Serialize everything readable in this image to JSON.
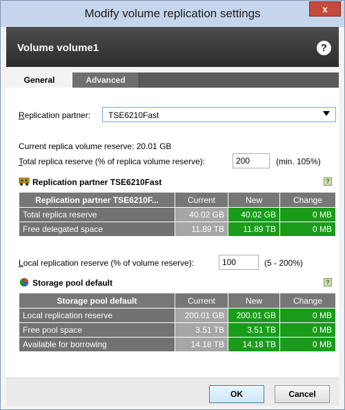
{
  "window": {
    "title": "Modify volume replication settings",
    "close_glyph": "x"
  },
  "header": {
    "title": "Volume volume1",
    "help_glyph": "?"
  },
  "tabs": [
    {
      "label": "General",
      "active": true
    },
    {
      "label": "Advanced",
      "active": false
    }
  ],
  "replication_partner": {
    "label_prefix": "R",
    "label_rest": "eplication partner:",
    "value": "TSE6210Fast"
  },
  "replica": {
    "current_reserve_text": "Current replica volume reserve:  20.01 GB",
    "total_label_prefix": "T",
    "total_label_rest": "otal replica reserve (% of replica volume reserve):",
    "total_value": "200",
    "total_hint": "(min. 105%)"
  },
  "partner_section": {
    "title": "Replication partner TSE6210Fast",
    "help_glyph": "?",
    "columns": [
      "Replication partner TSE6210F...",
      "Current",
      "New",
      "Change"
    ],
    "rows": [
      {
        "name": "Total replica reserve",
        "current": "40.02 GB",
        "new": "40.02 GB",
        "change": "0 MB"
      },
      {
        "name": "Free delegated space",
        "current": "11.89 TB",
        "new": "11.89 TB",
        "change": "0 MB"
      }
    ]
  },
  "local": {
    "label_prefix": "L",
    "label_rest": "ocal replication reserve (% of volume reserve):",
    "value": "100",
    "hint": "(5 - 200%)"
  },
  "pool_section": {
    "title": "Storage pool default",
    "help_glyph": "?",
    "columns": [
      "Storage pool default",
      "Current",
      "New",
      "Change"
    ],
    "rows": [
      {
        "name": "Local replication reserve",
        "current": "200.01 GB",
        "new": "200.01 GB",
        "change": "0 MB"
      },
      {
        "name": "Free pool space",
        "current": "3.51 TB",
        "new": "3.51 TB",
        "change": "0 MB"
      },
      {
        "name": "Available for borrowing",
        "current": "14.18 TB",
        "new": "14.18 TB",
        "change": "0 MB"
      }
    ]
  },
  "footer": {
    "ok_label": "OK",
    "cancel_label": "Cancel"
  },
  "colors": {
    "accent_green": "#1a9c1a",
    "header_dark": "#2c2c2c",
    "title_bar": "#c5d6ec",
    "close_red": "#c44a3c"
  }
}
